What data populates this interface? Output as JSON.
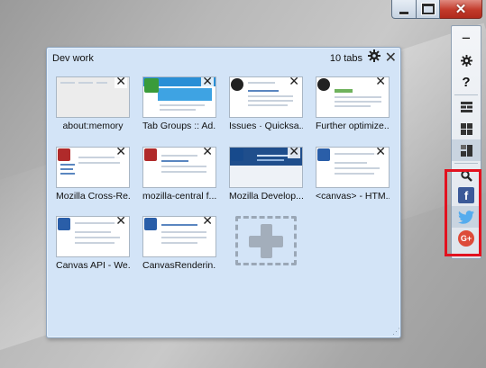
{
  "window": {
    "minimize_glyph": "minimize-icon",
    "maximize_glyph": "maximize-icon",
    "close_glyph": "✕"
  },
  "group": {
    "title": "Dev work",
    "tab_count": "10 tabs",
    "settings_icon": "gear-icon",
    "close_icon": "✕",
    "resize_icon": "⋰",
    "tabs": [
      {
        "label": "about:memory",
        "favicon": "none"
      },
      {
        "label": "Tab Groups :: Ad...",
        "favicon": "addon-icon"
      },
      {
        "label": "Issues · Quicksa...",
        "favicon": "github-icon"
      },
      {
        "label": "Further optimize...",
        "favicon": "github-icon"
      },
      {
        "label": "Mozilla Cross-Re...",
        "favicon": "mxr-icon"
      },
      {
        "label": "mozilla-central f...",
        "favicon": "mxr-icon"
      },
      {
        "label": "Mozilla Develop...",
        "favicon": "mdn-icon"
      },
      {
        "label": "<canvas> - HTM...",
        "favicon": "mdn-icon"
      },
      {
        "label": "Canvas API - We...",
        "favicon": "mdn-icon"
      },
      {
        "label": "CanvasRenderin...",
        "favicon": "mdn-icon"
      }
    ],
    "new_tab_icon": "plus-icon"
  },
  "toolbar": {
    "items": [
      {
        "name": "minimize",
        "glyph": "−"
      },
      {
        "name": "settings",
        "glyph": "✱"
      },
      {
        "name": "help",
        "glyph": "?"
      },
      {
        "name": "layout-rows",
        "glyph": "rows-icon"
      },
      {
        "name": "layout-grid",
        "glyph": "grid-icon"
      },
      {
        "name": "layout-mixed",
        "glyph": "mixed-layout-icon"
      },
      {
        "name": "search",
        "glyph": "search-icon"
      },
      {
        "name": "facebook",
        "glyph": "f"
      },
      {
        "name": "twitter",
        "glyph": "bird"
      },
      {
        "name": "google-plus",
        "glyph": "G+"
      }
    ]
  },
  "colors": {
    "panel_bg": "#d3e4f7",
    "highlight_border": "#e2121f",
    "facebook": "#3b5998",
    "twitter": "#55acee",
    "google_plus": "#dd4b39"
  }
}
